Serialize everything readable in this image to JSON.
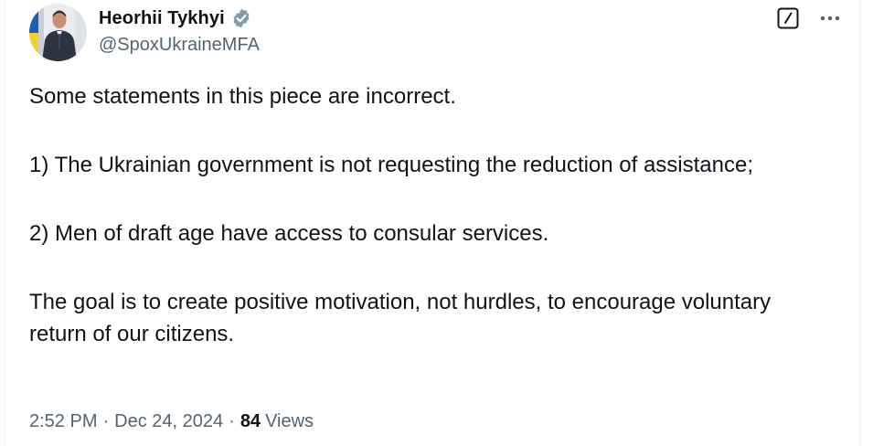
{
  "author": {
    "name": "Heorhii Tykhyi",
    "handle": "@SpoxUkraineMFA",
    "verified_icon": "verified-badge-icon",
    "verified_color": "#829aab",
    "avatar_colors": {
      "blue": "#1b5fb0",
      "yellow": "#f3d02c"
    }
  },
  "actions": {
    "edit_icon": "edit-icon",
    "more_icon": "more-icon"
  },
  "tweet": {
    "lines": [
      "Some statements in this piece are incorrect.",
      "1) The Ukrainian government is not requesting the reduction of assistance;",
      "2) Men of draft age have access to consular services.",
      "The goal is to create positive motivation, not hurdles, to encourage voluntary return of our citizens."
    ]
  },
  "meta": {
    "time": "2:52 PM",
    "separator": "·",
    "date": "Dec 24, 2024",
    "views_count": "84",
    "views_label": "Views"
  }
}
